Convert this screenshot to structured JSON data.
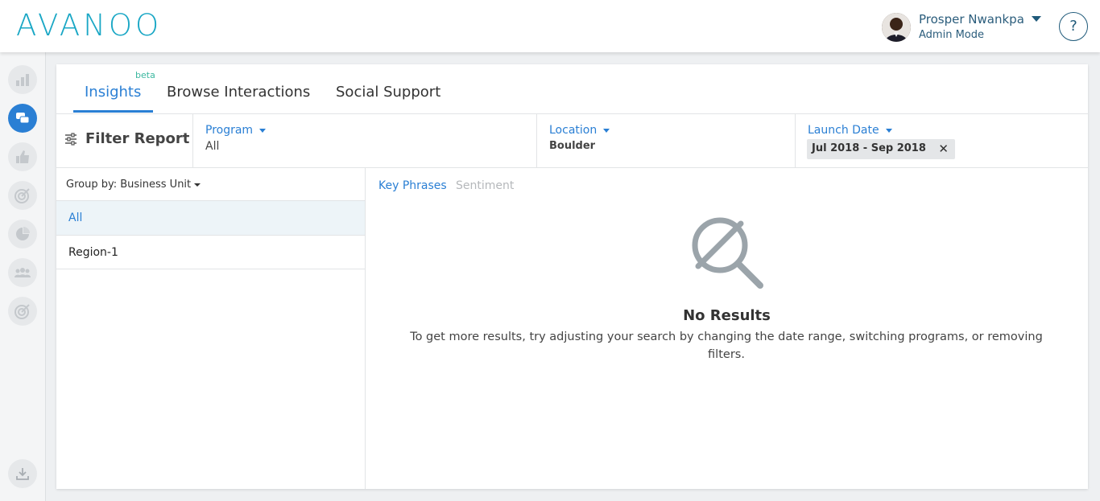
{
  "header": {
    "logo_text": "AVANOO",
    "user_name": "Prosper Nwankpa",
    "user_mode": "Admin Mode",
    "help_label": "?"
  },
  "sidebar": {
    "items": [
      {
        "icon": "bar-chart-icon",
        "active": false
      },
      {
        "icon": "chat-bubbles-icon",
        "active": true
      },
      {
        "icon": "thumbs-up-icon",
        "active": false
      },
      {
        "icon": "target-icon",
        "active": false
      },
      {
        "icon": "pie-chart-icon",
        "active": false
      },
      {
        "icon": "people-group-icon",
        "active": false
      },
      {
        "icon": "target-icon",
        "active": false
      }
    ],
    "bottom_icon": "download-icon"
  },
  "tabs": {
    "items": [
      {
        "label": "Insights",
        "active": true
      },
      {
        "label": "Browse Interactions",
        "active": false
      },
      {
        "label": "Social Support",
        "active": false
      }
    ],
    "beta_label": "beta"
  },
  "filters": {
    "title": "Filter Report",
    "program": {
      "label": "Program",
      "value": "All"
    },
    "location": {
      "label": "Location",
      "value": "Boulder"
    },
    "launch_date": {
      "label": "Launch Date",
      "value": "Jul 2018 - Sep 2018"
    }
  },
  "left_panel": {
    "group_by": "Group by: Business Unit",
    "rows": [
      {
        "label": "All",
        "selected": true
      },
      {
        "label": "Region-1",
        "selected": false
      }
    ]
  },
  "results": {
    "subtabs": [
      {
        "label": "Key Phrases",
        "active": true
      },
      {
        "label": "Sentiment",
        "active": false
      }
    ],
    "empty_title": "No Results",
    "empty_description": "To get more results, try adjusting your search by changing the date range, switching programs, or removing filters."
  },
  "colors": {
    "accent": "#2a7fd4",
    "logo": "#1aa7c5",
    "beta": "#3cb8a0",
    "header_text": "#2b5d7c"
  }
}
